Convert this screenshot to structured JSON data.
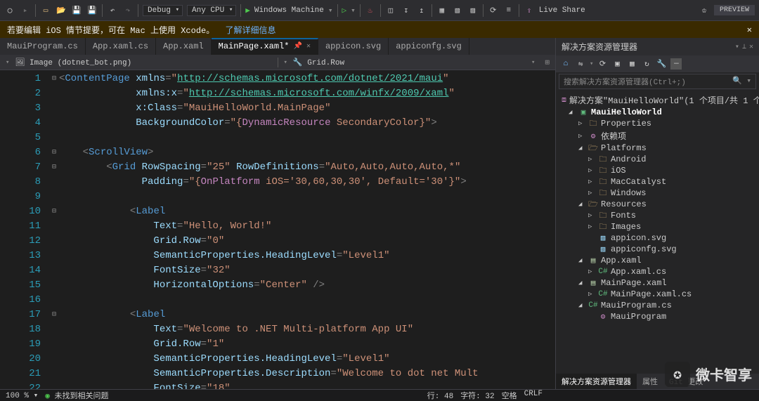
{
  "toolbar": {
    "config": "Debug",
    "platform": "Any CPU",
    "target": "Windows Machine",
    "liveShare": "Live Share",
    "preview": "PREVIEW"
  },
  "notification": {
    "text": "若要编辑 iOS 情节提要，可在 Mac 上使用 Xcode。",
    "link": "了解详细信息"
  },
  "tabs": [
    {
      "label": "MauiProgram.cs"
    },
    {
      "label": "App.xaml.cs"
    },
    {
      "label": "App.xaml"
    },
    {
      "label": "MainPage.xaml*",
      "active": true,
      "pinned": true
    },
    {
      "label": "appicon.svg"
    },
    {
      "label": "appiconfg.svg"
    }
  ],
  "crumb": {
    "left": "Image (dotnet_bot.png)",
    "right": "Grid.Row"
  },
  "code": {
    "lines": [
      {
        "n": 1,
        "html": "<span class='c-punc'>&lt;</span><span class='c-tag'>ContentPage</span> <span class='c-attr'>xmlns</span><span class='c-punc'>=</span><span class='c-str'>\"</span><span class='c-url'>http://schemas.microsoft.com/dotnet/2021/maui</span><span class='c-str'>\"</span>"
      },
      {
        "n": 2,
        "html": "             <span class='c-attr'>xmlns:x</span><span class='c-punc'>=</span><span class='c-str'>\"</span><span class='c-url'>http://schemas.microsoft.com/winfx/2009/xaml</span><span class='c-str'>\"</span>"
      },
      {
        "n": 3,
        "html": "             <span class='c-attr'>x:Class</span><span class='c-punc'>=</span><span class='c-str'>\"MauiHelloWorld.MainPage\"</span>"
      },
      {
        "n": 4,
        "html": "             <span class='c-attr'>BackgroundColor</span><span class='c-punc'>=</span><span class='c-str'>\"{</span><span class='c-res'>DynamicResource</span><span class='c-str'> SecondaryColor}\"</span><span class='c-punc'>&gt;</span>"
      },
      {
        "n": 5,
        "html": ""
      },
      {
        "n": 6,
        "html": "    <span class='c-punc'>&lt;</span><span class='c-tag'>ScrollView</span><span class='c-punc'>&gt;</span>"
      },
      {
        "n": 7,
        "html": "        <span class='c-punc'>&lt;</span><span class='c-tag'>Grid</span> <span class='c-attr'>RowSpacing</span><span class='c-punc'>=</span><span class='c-str'>\"25\"</span> <span class='c-attr'>RowDefinitions</span><span class='c-punc'>=</span><span class='c-str'>\"Auto,Auto,Auto,Auto,*\"</span>"
      },
      {
        "n": 8,
        "html": "              <span class='c-attr'>Padding</span><span class='c-punc'>=</span><span class='c-str'>\"{</span><span class='c-res'>OnPlatform</span><span class='c-str'> iOS='30,60,30,30', Default='30'}\"</span><span class='c-punc'>&gt;</span>"
      },
      {
        "n": 9,
        "html": ""
      },
      {
        "n": 10,
        "html": "            <span class='c-punc'>&lt;</span><span class='c-tag'>Label</span>"
      },
      {
        "n": 11,
        "html": "                <span class='c-attr'>Text</span><span class='c-punc'>=</span><span class='c-str'>\"Hello, World!\"</span>"
      },
      {
        "n": 12,
        "html": "                <span class='c-attr'>Grid.Row</span><span class='c-punc'>=</span><span class='c-str'>\"0\"</span>"
      },
      {
        "n": 13,
        "html": "                <span class='c-attr'>SemanticProperties.HeadingLevel</span><span class='c-punc'>=</span><span class='c-str'>\"Level1\"</span>"
      },
      {
        "n": 14,
        "html": "                <span class='c-attr'>FontSize</span><span class='c-punc'>=</span><span class='c-str'>\"32\"</span>"
      },
      {
        "n": 15,
        "html": "                <span class='c-attr'>HorizontalOptions</span><span class='c-punc'>=</span><span class='c-str'>\"Center\"</span> <span class='c-punc'>/&gt;</span>"
      },
      {
        "n": 16,
        "html": ""
      },
      {
        "n": 17,
        "html": "            <span class='c-punc'>&lt;</span><span class='c-tag'>Label</span>"
      },
      {
        "n": 18,
        "html": "                <span class='c-attr'>Text</span><span class='c-punc'>=</span><span class='c-str'>\"Welcome to .NET Multi-platform App UI\"</span>"
      },
      {
        "n": 19,
        "html": "                <span class='c-attr'>Grid.Row</span><span class='c-punc'>=</span><span class='c-str'>\"1\"</span>"
      },
      {
        "n": 20,
        "html": "                <span class='c-attr'>SemanticProperties.HeadingLevel</span><span class='c-punc'>=</span><span class='c-str'>\"Level1\"</span>"
      },
      {
        "n": 21,
        "html": "                <span class='c-attr'>SemanticProperties.Description</span><span class='c-punc'>=</span><span class='c-str'>\"Welcome to dot net Mult</span>"
      },
      {
        "n": 22,
        "html": "                <span class='c-attr'>FontSize</span><span class='c-punc'>=</span><span class='c-str'>\"18\"</span>"
      }
    ],
    "folds": {
      "1": "⊟",
      "6": "⊟",
      "7": "⊟",
      "10": "⊟",
      "17": "⊟"
    }
  },
  "solutionExplorer": {
    "title": "解决方案资源管理器",
    "search": "搜索解决方案资源管理器(Ctrl+;)",
    "tree": [
      {
        "ind": 0,
        "exp": "",
        "icon": "sol",
        "label": "解决方案\"MauiHelloWorld\"(1 个项目/共 1 个)"
      },
      {
        "ind": 1,
        "exp": "▢",
        "icon": "csproj",
        "label": "MauiHelloWorld",
        "bold": true
      },
      {
        "ind": 2,
        "exp": "▷",
        "icon": "folder",
        "label": "Properties"
      },
      {
        "ind": 2,
        "exp": "▷",
        "icon": "deps",
        "label": "依赖项"
      },
      {
        "ind": 2,
        "exp": "▢",
        "icon": "folder-open",
        "label": "Platforms"
      },
      {
        "ind": 3,
        "exp": "▷",
        "icon": "folder",
        "label": "Android"
      },
      {
        "ind": 3,
        "exp": "▷",
        "icon": "folder",
        "label": "iOS"
      },
      {
        "ind": 3,
        "exp": "▷",
        "icon": "folder",
        "label": "MacCatalyst"
      },
      {
        "ind": 3,
        "exp": "▷",
        "icon": "folder",
        "label": "Windows"
      },
      {
        "ind": 2,
        "exp": "▢",
        "icon": "folder-open",
        "label": "Resources"
      },
      {
        "ind": 3,
        "exp": "▷",
        "icon": "folder",
        "label": "Fonts"
      },
      {
        "ind": 3,
        "exp": "▷",
        "icon": "folder",
        "label": "Images"
      },
      {
        "ind": 3,
        "exp": "",
        "icon": "svg",
        "label": "appicon.svg"
      },
      {
        "ind": 3,
        "exp": "",
        "icon": "svg",
        "label": "appiconfg.svg"
      },
      {
        "ind": 2,
        "exp": "▢",
        "icon": "xaml",
        "label": "App.xaml"
      },
      {
        "ind": 3,
        "exp": "▷",
        "icon": "cs",
        "label": "App.xaml.cs"
      },
      {
        "ind": 2,
        "exp": "▢",
        "icon": "xaml",
        "label": "MainPage.xaml"
      },
      {
        "ind": 3,
        "exp": "▷",
        "icon": "cs",
        "label": "MainPage.xaml.cs"
      },
      {
        "ind": 2,
        "exp": "▢",
        "icon": "cs",
        "label": "MauiProgram.cs"
      },
      {
        "ind": 3,
        "exp": "",
        "icon": "deps",
        "label": "MauiProgram"
      }
    ],
    "bottomTabs": [
      "解决方案资源管理器",
      "属性",
      "Git 更改"
    ]
  },
  "status": {
    "zoom": "100 %",
    "issues": "未找到相关问题",
    "line": "行: 48",
    "chars": "字符: 32",
    "spaces": "空格",
    "crlf": "CRLF"
  },
  "sideTab": "属性",
  "watermark": "微卡智享"
}
